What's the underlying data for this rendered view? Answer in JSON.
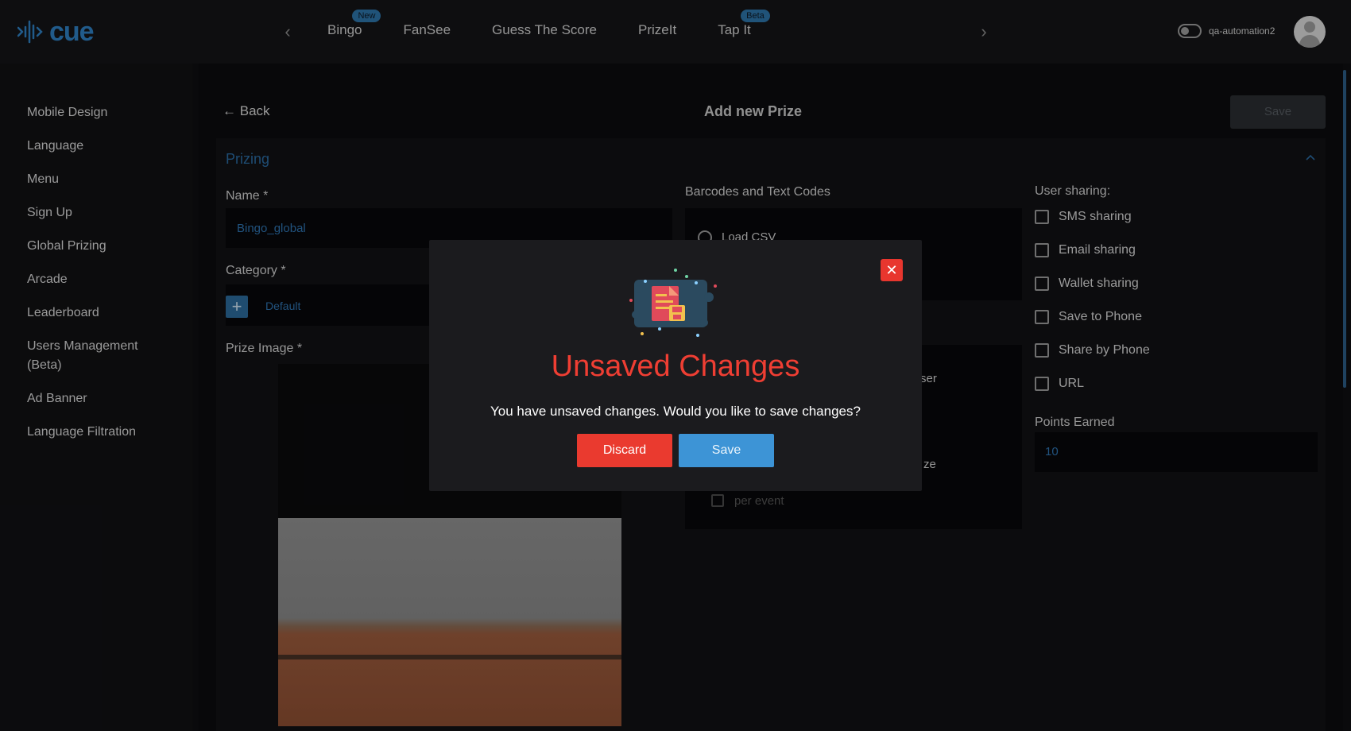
{
  "app": {
    "logo_text": "cue"
  },
  "nav": {
    "items": [
      {
        "label": "Bingo",
        "badge": "New"
      },
      {
        "label": "FanSee",
        "badge": null
      },
      {
        "label": "Guess The Score",
        "badge": null
      },
      {
        "label": "PrizeIt",
        "badge": null
      },
      {
        "label": "Tap It",
        "badge": "Beta"
      }
    ]
  },
  "user": {
    "name": "qa-automation2"
  },
  "sidebar": {
    "items": [
      {
        "label": "Mobile Design"
      },
      {
        "label": "Language"
      },
      {
        "label": "Menu"
      },
      {
        "label": "Sign Up"
      },
      {
        "label": "Global Prizing"
      },
      {
        "label": "Arcade"
      },
      {
        "label": "Leaderboard"
      },
      {
        "label": "Users Management (Beta)"
      },
      {
        "label": "Ad Banner"
      },
      {
        "label": "Language Filtration"
      }
    ]
  },
  "page": {
    "back_label": "Back",
    "title": "Add new Prize",
    "save_label": "Save",
    "section_title": "Prizing"
  },
  "form": {
    "name_label": "Name *",
    "name_value": "Bingo_global",
    "category_label": "Category *",
    "category_value": "Default",
    "image_label": "Prize Image *",
    "codes_label": "Barcodes and Text Codes",
    "load_csv_label": "Load CSV",
    "partial_text_1": "ser",
    "partial_text_2": "ze",
    "per_event_label": "per event"
  },
  "sharing": {
    "label": "User sharing:",
    "options": [
      {
        "label": "SMS sharing",
        "checked": false
      },
      {
        "label": "Email sharing",
        "checked": false
      },
      {
        "label": "Wallet sharing",
        "checked": false
      },
      {
        "label": "Save to Phone",
        "checked": false
      },
      {
        "label": "Share by Phone",
        "checked": false
      },
      {
        "label": "URL",
        "checked": false
      }
    ],
    "points_label": "Points Earned",
    "points_value": "10"
  },
  "modal": {
    "title": "Unsaved Changes",
    "message": "You have unsaved changes. Would you like to save changes?",
    "discard_label": "Discard",
    "save_label": "Save"
  },
  "colors": {
    "accent": "#2f7fc1",
    "danger": "#ea3a2f",
    "primary_button": "#3d94d6"
  }
}
